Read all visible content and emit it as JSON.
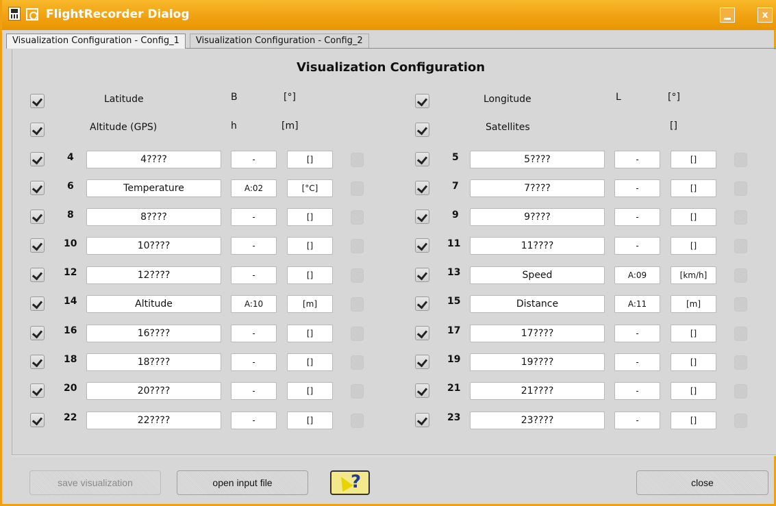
{
  "window": {
    "title": "FlightRecorder Dialog",
    "minimize_label": "",
    "close_label": "x"
  },
  "tabs": [
    {
      "label": "Visualization Configuration - Config_1"
    },
    {
      "label": "Visualization Configuration - Config_2"
    }
  ],
  "heading": "Visualization Configuration",
  "fixed_rows": [
    {
      "label": "Latitude",
      "symbol": "B",
      "unit": "[°]"
    },
    {
      "label": "Altitude (GPS)",
      "symbol": "h",
      "unit": "[m]"
    },
    {
      "label": "Longitude",
      "symbol": "L",
      "unit": "[°]"
    },
    {
      "label": "Satellites",
      "symbol": "",
      "unit": "[]"
    }
  ],
  "left_rows": [
    {
      "num": "4",
      "name": "4????",
      "channel": "-",
      "unit": "[]"
    },
    {
      "num": "6",
      "name": "Temperature",
      "channel": "A:02",
      "unit": "[°C]"
    },
    {
      "num": "8",
      "name": "8????",
      "channel": "-",
      "unit": "[]"
    },
    {
      "num": "10",
      "name": "10????",
      "channel": "-",
      "unit": "[]"
    },
    {
      "num": "12",
      "name": "12????",
      "channel": "-",
      "unit": "[]"
    },
    {
      "num": "14",
      "name": "Altitude",
      "channel": "A:10",
      "unit": "[m]"
    },
    {
      "num": "16",
      "name": "16????",
      "channel": "-",
      "unit": "[]"
    },
    {
      "num": "18",
      "name": "18????",
      "channel": "-",
      "unit": "[]"
    },
    {
      "num": "20",
      "name": "20????",
      "channel": "-",
      "unit": "[]"
    },
    {
      "num": "22",
      "name": "22????",
      "channel": "-",
      "unit": "[]"
    }
  ],
  "right_rows": [
    {
      "num": "5",
      "name": "5????",
      "channel": "-",
      "unit": "[]"
    },
    {
      "num": "7",
      "name": "7????",
      "channel": "-",
      "unit": "[]"
    },
    {
      "num": "9",
      "name": "9????",
      "channel": "-",
      "unit": "[]"
    },
    {
      "num": "11",
      "name": "11????",
      "channel": "-",
      "unit": "[]"
    },
    {
      "num": "13",
      "name": "Speed",
      "channel": "A:09",
      "unit": "[km/h]"
    },
    {
      "num": "15",
      "name": "Distance",
      "channel": "A:11",
      "unit": "[m]"
    },
    {
      "num": "17",
      "name": "17????",
      "channel": "-",
      "unit": "[]"
    },
    {
      "num": "19",
      "name": "19????",
      "channel": "-",
      "unit": "[]"
    },
    {
      "num": "21",
      "name": "21????",
      "channel": "-",
      "unit": "[]"
    },
    {
      "num": "23",
      "name": "23????",
      "channel": "-",
      "unit": "[]"
    }
  ],
  "buttons": {
    "save": "save visualization",
    "open": "open input file",
    "close": "close"
  },
  "colors": {
    "title_bar": "#f0a010",
    "help_bg": "#f3e98c"
  }
}
